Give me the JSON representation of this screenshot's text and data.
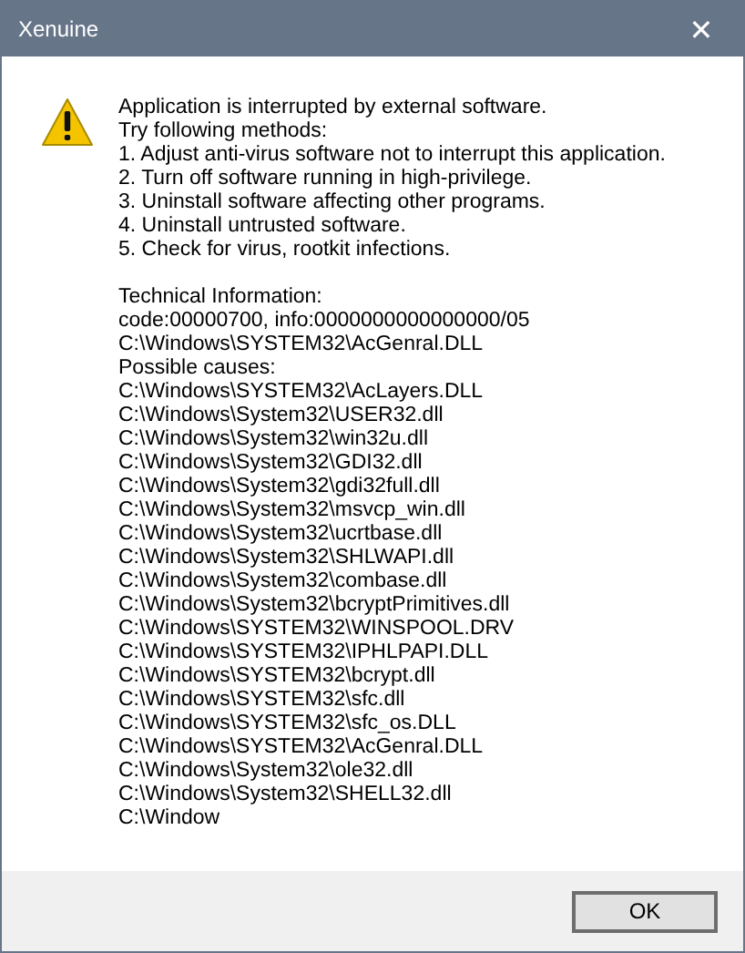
{
  "window": {
    "title": "Xenuine",
    "close": "✕"
  },
  "message": [
    "Application is interrupted by external software.",
    "Try following methods:",
    "1. Adjust anti-virus software not to interrupt this application.",
    "2. Turn off software running in high-privilege.",
    "3. Uninstall software affecting other programs.",
    "4. Uninstall untrusted software.",
    "5. Check for virus, rootkit infections."
  ],
  "technical": [
    "Technical Information:",
    "code:00000700, info:0000000000000000/05",
    "C:\\Windows\\SYSTEM32\\AcGenral.DLL",
    "Possible causes:",
    "C:\\Windows\\SYSTEM32\\AcLayers.DLL",
    "C:\\Windows\\System32\\USER32.dll",
    "C:\\Windows\\System32\\win32u.dll",
    "C:\\Windows\\System32\\GDI32.dll",
    "C:\\Windows\\System32\\gdi32full.dll",
    "C:\\Windows\\System32\\msvcp_win.dll",
    "C:\\Windows\\System32\\ucrtbase.dll",
    "C:\\Windows\\System32\\SHLWAPI.dll",
    "C:\\Windows\\System32\\combase.dll",
    "C:\\Windows\\System32\\bcryptPrimitives.dll",
    "C:\\Windows\\SYSTEM32\\WINSPOOL.DRV",
    "C:\\Windows\\SYSTEM32\\IPHLPAPI.DLL",
    "C:\\Windows\\SYSTEM32\\bcrypt.dll",
    "C:\\Windows\\SYSTEM32\\sfc.dll",
    "C:\\Windows\\SYSTEM32\\sfc_os.DLL",
    "C:\\Windows\\SYSTEM32\\AcGenral.DLL",
    "C:\\Windows\\System32\\ole32.dll",
    "C:\\Windows\\System32\\SHELL32.dll",
    "C:\\Window"
  ],
  "buttons": [
    "OK"
  ]
}
